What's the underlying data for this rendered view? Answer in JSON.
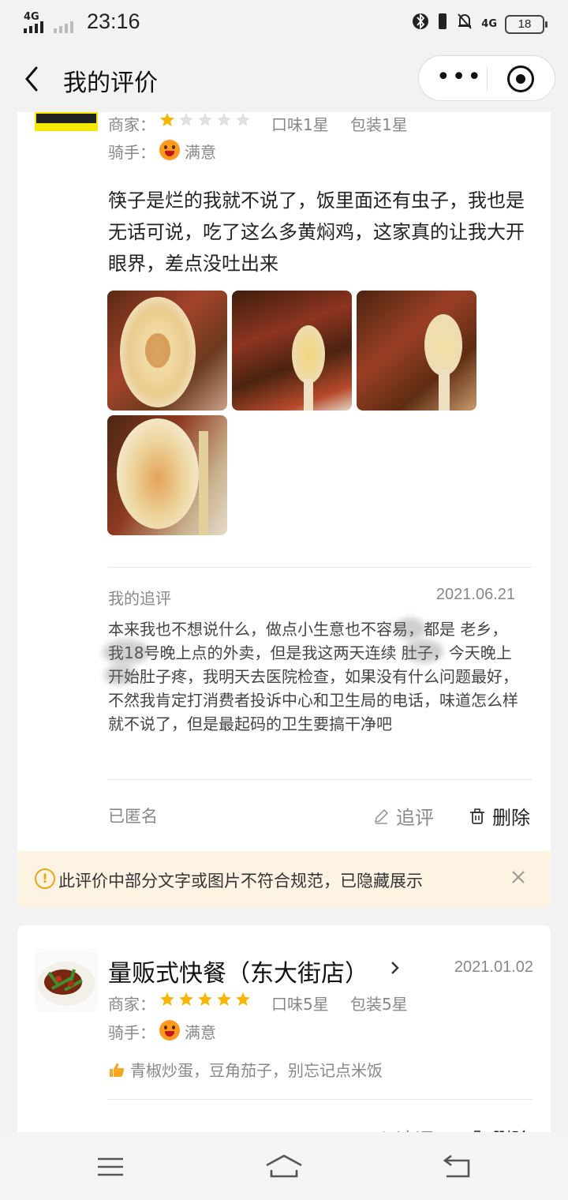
{
  "status": {
    "network1": "4G",
    "network2": "4G",
    "time": "23:16",
    "battery": "18"
  },
  "nav": {
    "title": "我的评价",
    "more": "•••"
  },
  "review1": {
    "merchant_label": "商家：",
    "merchant_stars": 1,
    "taste": "口味1星",
    "package": "包装1星",
    "rider_label": "骑手：",
    "rider_rating": "满意",
    "text": "筷子是烂的我就不说了，饭里面还有虫子，我也是无话可说，吃了这么多黄焖鸡，这家真的让我大开眼界，差点没吐出来",
    "followup_title": "我的追评",
    "followup_date": "2021.06.21",
    "followup_text": "本来我也不想说什么，做点小生意也不容易，都是 老乡，我18号晚上点的外卖，但是我这两天连续 肚子，今天晚上开始肚子疼，我明天去医院检查，如果没有什么问题最好，不然我肯定打消费者投诉中心和卫生局的电话，味道怎么样就不说了，但是最起码的卫生要搞干净吧",
    "anonymous": "已匿名",
    "followup_btn": "追评",
    "delete_btn": "删除"
  },
  "notice": {
    "text": "此评价中部分文字或图片不符合规范，已隐藏展示"
  },
  "review2": {
    "shop_name": "量贩式快餐（东大街店）",
    "date": "2021.01.02",
    "merchant_label": "商家：",
    "merchant_stars": 5,
    "taste": "口味5星",
    "package": "包装5星",
    "rider_label": "骑手：",
    "rider_rating": "满意",
    "like_text": "青椒炒蛋，豆角茄子，别忘记点米饭",
    "followup_btn": "追评",
    "delete_btn": "删除"
  },
  "colors": {
    "star_on": "#f7b500",
    "star_off": "#e0e0e0",
    "notice_bg": "#fdf3e3",
    "warn": "#e8a71a"
  }
}
